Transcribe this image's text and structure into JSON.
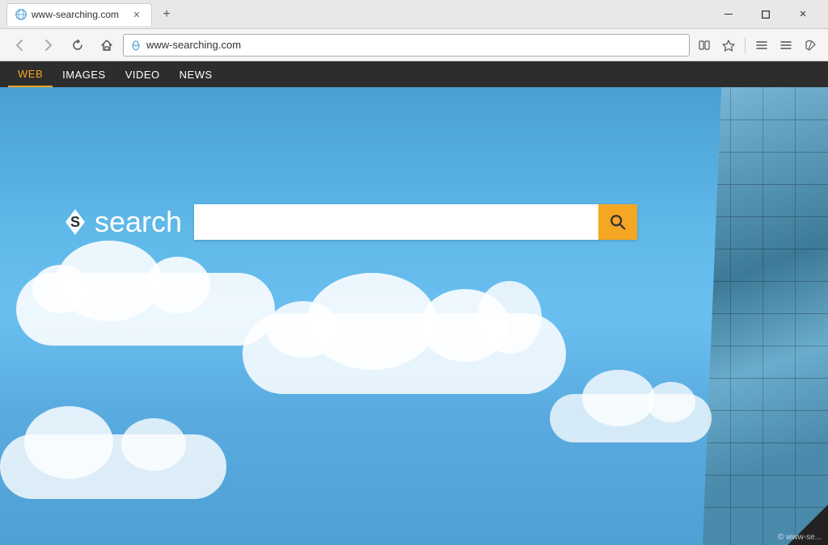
{
  "browser": {
    "tab_title": "www-searching.com",
    "tab_favicon": "globe",
    "url": "www-searching.com",
    "new_tab_label": "+",
    "window_controls": {
      "minimize": "—",
      "maximize": "",
      "close": "✕"
    }
  },
  "nav_menu": {
    "items": [
      {
        "id": "web",
        "label": "WEB",
        "active": true
      },
      {
        "id": "images",
        "label": "IMAGES",
        "active": false
      },
      {
        "id": "video",
        "label": "VIDEO",
        "active": false
      },
      {
        "id": "news",
        "label": "NEWS",
        "active": false
      }
    ]
  },
  "main": {
    "brand_name": "search",
    "search_placeholder": "",
    "search_button_icon": "search-icon"
  },
  "footer": {
    "watermark": "© www-se..."
  },
  "colors": {
    "accent": "#f5a623",
    "nav_bg": "#2d2d2d",
    "nav_active": "#f5a623"
  }
}
